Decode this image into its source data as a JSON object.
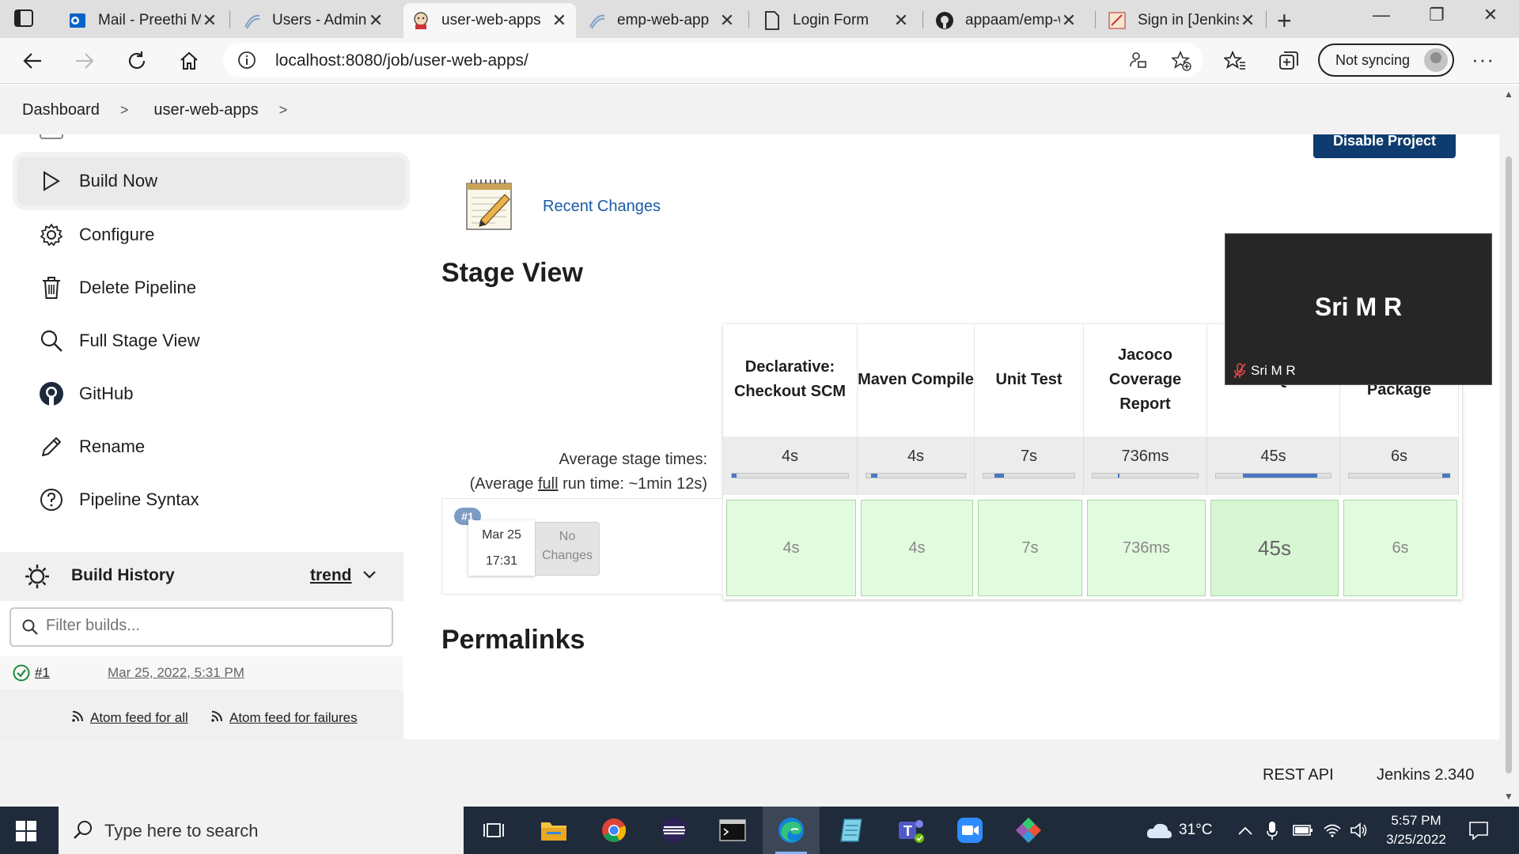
{
  "browser": {
    "tabs": [
      {
        "title": "Mail - Preethi M",
        "icon": "outlook-icon"
      },
      {
        "title": "Users - Administrator",
        "icon": "jenkins-swirl-icon"
      },
      {
        "title": "user-web-apps",
        "icon": "jenkins-icon",
        "active": true
      },
      {
        "title": "emp-web-app",
        "icon": "jenkins-swirl-icon"
      },
      {
        "title": "Login Form",
        "icon": "document-icon"
      },
      {
        "title": "appaam/emp-web",
        "icon": "github-icon"
      },
      {
        "title": "Sign in [Jenkins]",
        "icon": "jenkins-icon"
      }
    ],
    "url": "localhost:8080/job/user-web-apps/",
    "sync_label": "Not syncing"
  },
  "breadcrumb": [
    "Dashboard",
    "user-web-apps"
  ],
  "sidebar": {
    "items": [
      {
        "label": "Build Now",
        "icon": "play-icon"
      },
      {
        "label": "Configure",
        "icon": "gear-icon"
      },
      {
        "label": "Delete Pipeline",
        "icon": "trash-icon"
      },
      {
        "label": "Full Stage View",
        "icon": "search-icon"
      },
      {
        "label": "GitHub",
        "icon": "github-icon"
      },
      {
        "label": "Rename",
        "icon": "pencil-icon"
      },
      {
        "label": "Pipeline Syntax",
        "icon": "help-icon"
      }
    ],
    "build_history": {
      "title": "Build History",
      "trend_label": "trend",
      "filter_placeholder": "Filter builds...",
      "builds": [
        {
          "number": "#1",
          "date": "Mar 25, 2022, 5:31 PM",
          "status": "success"
        }
      ],
      "feed_all": "Atom feed for all",
      "feed_failures": "Atom feed for failures"
    }
  },
  "main": {
    "disable_button": "Disable Project",
    "recent_changes": "Recent Changes",
    "stage_view_title": "Stage View",
    "avg_label_line1": "Average stage times:",
    "avg_label_line2_pre": "(Average ",
    "avg_label_link": "full",
    "avg_label_line2_post": " run time: ~1min 12s)",
    "stages": [
      {
        "name": "Declarative: Checkout SCM",
        "avg": "4s",
        "run": "4s"
      },
      {
        "name": "Maven Compile",
        "avg": "4s",
        "run": "4s"
      },
      {
        "name": "Unit Test",
        "avg": "7s",
        "run": "7s"
      },
      {
        "name": "Jacoco Coverage Report",
        "avg": "736ms",
        "run": "736ms"
      },
      {
        "name": "SonarQube",
        "avg": "45s",
        "run": "45s"
      },
      {
        "name": "Package",
        "avg": "6s",
        "run": "6s"
      }
    ],
    "run": {
      "badge": "#1",
      "date": "Mar 25",
      "time": "17:31",
      "changes": "No Changes"
    },
    "permalinks_title": "Permalinks"
  },
  "video_overlay": {
    "name_large": "Sri M R",
    "name_small": "Sri M R"
  },
  "footer": {
    "rest_api": "REST API",
    "version": "Jenkins 2.340"
  },
  "taskbar": {
    "search_placeholder": "Type here to search",
    "weather": "31°C",
    "time": "5:57 PM",
    "date": "3/25/2022"
  },
  "colors": {
    "jenkins_blue": "#0f3c6e",
    "link": "#1a5aa8",
    "stage_success": "#e2fbdf",
    "taskbar": "#1f2a3a"
  }
}
